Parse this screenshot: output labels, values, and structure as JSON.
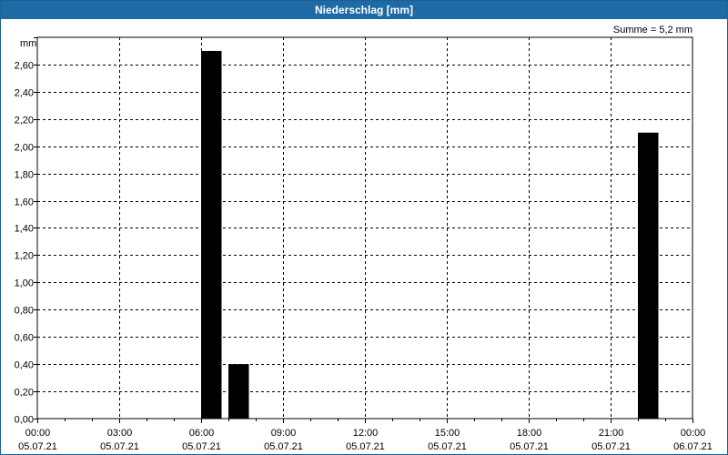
{
  "window": {
    "title": "Niederschlag [mm]"
  },
  "chart_data": {
    "type": "bar",
    "title": "Niederschlag [mm]",
    "ylabel": "mm",
    "annotation": "Summe = 5,2 mm",
    "ylim": [
      0,
      2.8
    ],
    "yticks": [
      "0,00",
      "0,20",
      "0,40",
      "0,60",
      "0,80",
      "1,00",
      "1,20",
      "1,40",
      "1,60",
      "1,80",
      "2,00",
      "2,20",
      "2,40",
      "2,60"
    ],
    "xlim_hours": [
      0,
      24
    ],
    "xticks": [
      {
        "time": "00:00",
        "date": "05.07.21"
      },
      {
        "time": "03:00",
        "date": "05.07.21"
      },
      {
        "time": "06:00",
        "date": "05.07.21"
      },
      {
        "time": "09:00",
        "date": "05.07.21"
      },
      {
        "time": "12:00",
        "date": "05.07.21"
      },
      {
        "time": "15:00",
        "date": "05.07.21"
      },
      {
        "time": "18:00",
        "date": "05.07.21"
      },
      {
        "time": "21:00",
        "date": "05.07.21"
      },
      {
        "time": "00:00",
        "date": "06.07.21"
      }
    ],
    "series": [
      {
        "points": [
          {
            "start": "06:00",
            "end": "06:45",
            "value": 2.7
          },
          {
            "start": "07:00",
            "end": "07:45",
            "value": 0.4
          },
          {
            "start": "22:00",
            "end": "22:45",
            "value": 2.1
          }
        ]
      }
    ],
    "grid": true,
    "colors": {
      "bar": "#000000",
      "title_bg": "#1d6aa5"
    }
  }
}
